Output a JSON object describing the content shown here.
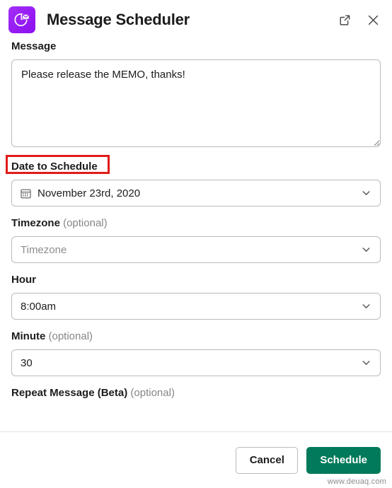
{
  "header": {
    "title": "Message Scheduler",
    "app_icon_name": "clock-envelope-icon",
    "accent_color": "#9b1ff5",
    "open_external_label": "Open in new window",
    "close_label": "Close"
  },
  "form": {
    "message": {
      "label": "Message",
      "value": "Please release the MEMO, thanks!",
      "placeholder": "Message"
    },
    "date": {
      "label": "Date to Schedule",
      "value": "November 23rd, 2020",
      "icon": "calendar-icon"
    },
    "timezone": {
      "label": "Timezone",
      "optional": "(optional)",
      "value": "",
      "placeholder": "Timezone"
    },
    "hour": {
      "label": "Hour",
      "value": "8:00am"
    },
    "minute": {
      "label": "Minute",
      "optional": "(optional)",
      "value": "30"
    },
    "repeat": {
      "label": "Repeat Message (Beta)",
      "optional": "(optional)"
    }
  },
  "annotation": {
    "target": "Date to Schedule",
    "color": "#e01b19"
  },
  "footer": {
    "cancel_label": "Cancel",
    "submit_label": "Schedule",
    "submit_color": "#007a5a"
  },
  "watermark": {
    "text": "www.deuaq.com"
  }
}
